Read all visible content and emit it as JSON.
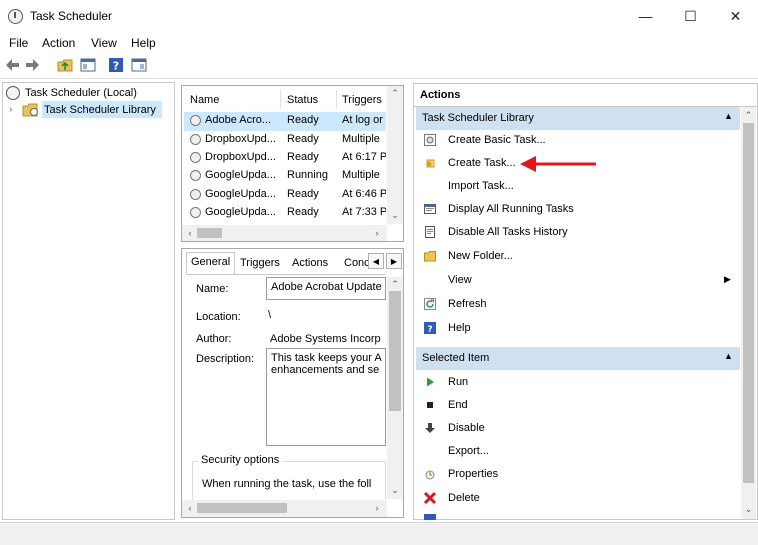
{
  "window": {
    "title": "Task Scheduler",
    "controls": {
      "minimize": "—",
      "maximize": "☐",
      "close": "✕"
    }
  },
  "menu": [
    "File",
    "Action",
    "View",
    "Help"
  ],
  "tree": {
    "root": "Task Scheduler (Local)",
    "child": "Task Scheduler Library"
  },
  "tasks": {
    "columns": [
      "Name",
      "Status",
      "Triggers"
    ],
    "rows": [
      {
        "name": "Adobe Acro...",
        "status": "Ready",
        "triggers": "At log or"
      },
      {
        "name": "DropboxUpd...",
        "status": "Ready",
        "triggers": "Multiple"
      },
      {
        "name": "DropboxUpd...",
        "status": "Ready",
        "triggers": "At 6:17 P"
      },
      {
        "name": "GoogleUpda...",
        "status": "Running",
        "triggers": "Multiple"
      },
      {
        "name": "GoogleUpda...",
        "status": "Ready",
        "triggers": "At 6:46 P"
      },
      {
        "name": "GoogleUpda...",
        "status": "Ready",
        "triggers": "At 7:33 P"
      }
    ]
  },
  "details": {
    "tabs": [
      "General",
      "Triggers",
      "Actions",
      "Conc"
    ],
    "name_label": "Name:",
    "name_value": "Adobe Acrobat Update",
    "location_label": "Location:",
    "location_value": "\\",
    "author_label": "Author:",
    "author_value": "Adobe Systems Incorp",
    "description_label": "Description:",
    "description_line1": "This task keeps your A",
    "description_line2": "enhancements and se",
    "security_title": "Security options",
    "security_text": "When running the task, use the foll"
  },
  "actions": {
    "header": "Actions",
    "library_section": "Task Scheduler Library",
    "library_items": [
      {
        "label": "Create Basic Task...",
        "icon": "create-basic-task-icon"
      },
      {
        "label": "Create Task...",
        "icon": "create-task-icon"
      },
      {
        "label": "Import Task...",
        "icon": ""
      },
      {
        "label": "Display All Running Tasks",
        "icon": "running-tasks-icon"
      },
      {
        "label": "Disable All Tasks History",
        "icon": "history-icon"
      },
      {
        "label": "New Folder...",
        "icon": "folder-icon"
      },
      {
        "label": "View",
        "icon": ""
      },
      {
        "label": "Refresh",
        "icon": "refresh-icon"
      },
      {
        "label": "Help",
        "icon": "help-icon"
      }
    ],
    "selected_section": "Selected Item",
    "selected_items": [
      {
        "label": "Run",
        "icon": "run-icon"
      },
      {
        "label": "End",
        "icon": "end-icon"
      },
      {
        "label": "Disable",
        "icon": "disable-icon"
      },
      {
        "label": "Export...",
        "icon": ""
      },
      {
        "label": "Properties",
        "icon": "properties-icon"
      },
      {
        "label": "Delete",
        "icon": "delete-icon"
      }
    ]
  },
  "colors": {
    "section_header": "#cfe0f1",
    "selection": "#cce8ff",
    "annotation_arrow": "#e8141b",
    "delete_red": "#d4181f",
    "run_green": "#2e9a3a"
  }
}
